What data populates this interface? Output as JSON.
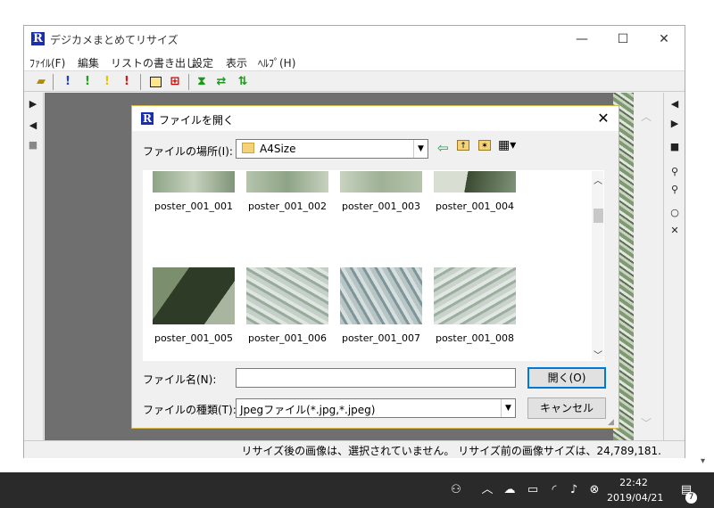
{
  "main_window": {
    "title": "デジカメまとめてリサイズ",
    "logo_letter": "R",
    "controls": {
      "minimize": "—",
      "maximize": "☐",
      "close": "✕"
    },
    "menu": [
      "ﾌｧｲﾙ(F)",
      "編集",
      "リストの書き出し",
      "設定",
      "表示",
      "ﾍﾙﾌﾟ(H)"
    ],
    "status_text": "リサイズ後の画像は、選択されていません。 リサイズ前の画像サイズは、24,789,181."
  },
  "toolbar_icons": [
    "open-folder-icon",
    "blue-exclamation-icon",
    "green-exclamation-icon",
    "yellow-exclamation-icon",
    "red-exclamation-icon",
    "frame-icon",
    "frame-cross-icon",
    "fit-icon",
    "swap-horizontal-icon",
    "swap-vertical-icon"
  ],
  "dialog": {
    "title": "ファイルを開く",
    "logo_letter": "R",
    "close": "✕",
    "look_in_label": "ファイルの場所(I):",
    "look_in_value": "A4Size",
    "filename_label": "ファイル名(N):",
    "filename_value": "",
    "filetype_label": "ファイルの種類(T):",
    "filetype_value": "Jpegファイル(*.jpg,*.jpeg)",
    "open_button": "開く(O)",
    "cancel_button": "キャンセル",
    "files": [
      "poster_001_001",
      "poster_001_002",
      "poster_001_003",
      "poster_001_004",
      "poster_001_005",
      "poster_001_006",
      "poster_001_007",
      "poster_001_008"
    ]
  },
  "taskbar": {
    "time": "22:42",
    "date": "2019/04/21",
    "notification_count": "7"
  }
}
